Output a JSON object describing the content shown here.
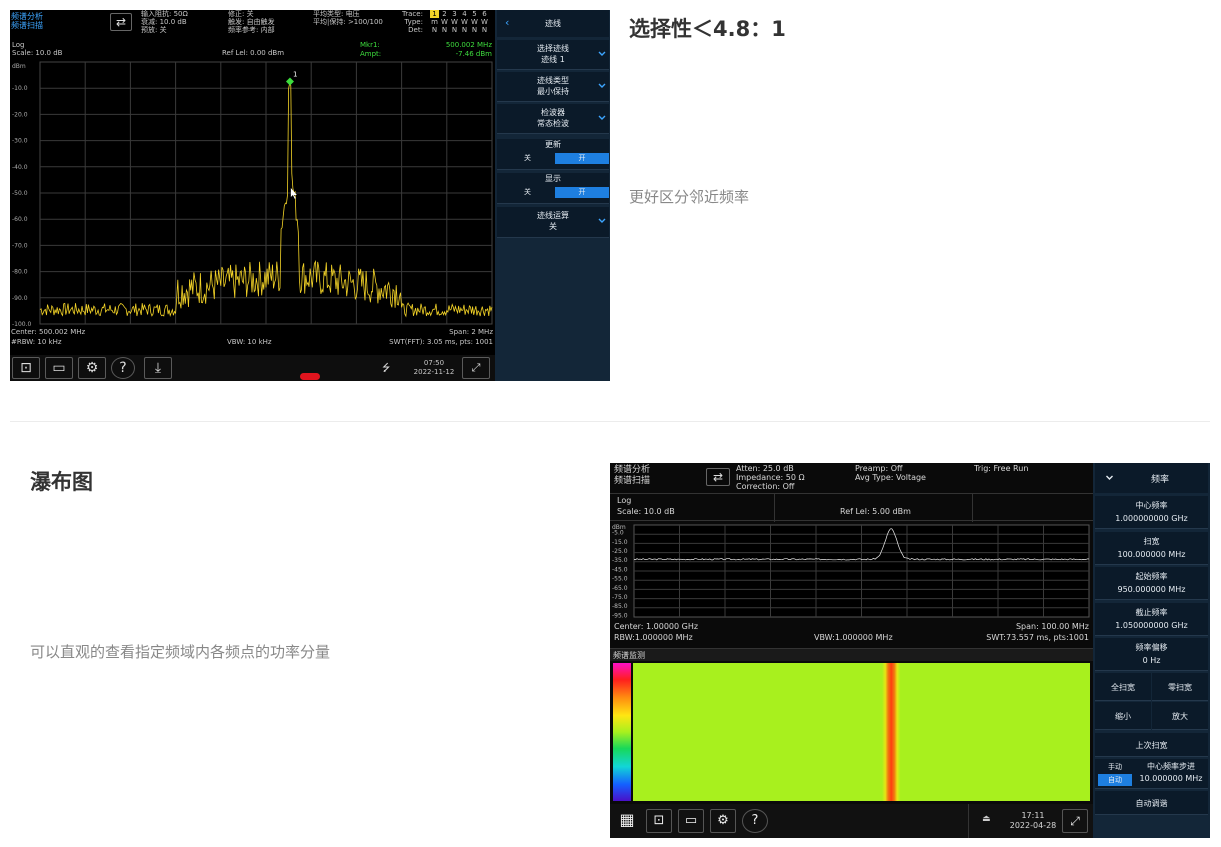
{
  "section1": {
    "title": "选择性＜4.8：1",
    "description": "更好区分邻近频率",
    "instrument": {
      "mode_line1": "频谱分析",
      "mode_line2": "频谱扫描",
      "hdr_col1": "输入阻抗: 50Ω\n衰减: 10.0 dB\n预放: 关",
      "hdr_col2": "修正: 关\n触发: 自由触发\n频率参考: 内部",
      "hdr_col3": "平均类型: 电压\n平均|保持: >100/100",
      "trace_label": "Trace:\nType:\nDet:",
      "trace_nums": [
        "1",
        "2",
        "3",
        "4",
        "5",
        "6"
      ],
      "trace_types": [
        "m",
        "W",
        "W",
        "W",
        "W",
        "W"
      ],
      "trace_dets": [
        "N",
        "N",
        "N",
        "N",
        "N",
        "N"
      ],
      "scale_type": "Log",
      "scale": "Scale: 10.0 dB",
      "ref_level": "Ref Lel: 0.00 dBm",
      "marker_label": "Mkr1:",
      "marker_freq": "500.002 MHz",
      "ampt_label": "Ampt:",
      "marker_ampt": "-7.46 dBm",
      "marker_num": "1",
      "y_unit": "dBm",
      "y_ticks": [
        "-10.0",
        "-20.0",
        "-30.0",
        "-40.0",
        "-50.0",
        "-60.0",
        "-70.0",
        "-80.0",
        "-90.0",
        "-100.0"
      ],
      "center": "Center: 500.002 MHz",
      "span": "Span: 2 MHz",
      "rbw": "#RBW: 10 kHz",
      "vbw": "VBW: 10 kHz",
      "swt": "SWT(FFT): 3.05 ms, pts: 1001",
      "time": "07:50",
      "date": "2022-11-12",
      "usb_icon": "usb-icon",
      "menu_title": "迹线",
      "menu": [
        {
          "l1": "选择迹线",
          "l2": "迹线 1"
        },
        {
          "l1": "迹线类型",
          "l2": "最小保持"
        },
        {
          "l1": "检波器",
          "l2": "常态检波"
        }
      ],
      "update_label": "更新",
      "display_label": "显示",
      "off": "关",
      "on": "开",
      "trace_math_l1": "迹线运算",
      "trace_math_l2": "关",
      "colors": {
        "trace": "#f3d327",
        "marker": "#3ddc3d",
        "accent": "#1e7fe0"
      }
    }
  },
  "section2": {
    "title": "瀑布图",
    "description": "可以直观的查看指定频域内各频点的功率分量",
    "instrument": {
      "mode_line1": "频谱分析",
      "mode_line2": "频谱扫描",
      "hdr_col1": "Atten: 25.0 dB\nImpedance: 50 Ω\nCorrection: Off",
      "hdr_col2": "Preamp: Off\nAvg Type: Voltage",
      "hdr_col3": "Trig: Free Run",
      "scale_type": "Log",
      "scale": "Scale: 10.0 dB",
      "ref_level": "Ref Lel: 5.00 dBm",
      "y_unit": "dBm",
      "y_ticks": [
        "-5.0",
        "-15.0",
        "-25.0",
        "-35.0",
        "-45.0",
        "-55.0",
        "-65.0",
        "-75.0",
        "-85.0",
        "-95.0"
      ],
      "center": "Center: 1.00000 GHz",
      "span": "Span: 100.00 MHz",
      "rbw": "RBW:1.000000 MHz",
      "vbw": "VBW:1.000000 MHz",
      "swt": "SWT:73.557 ms, pts:1001",
      "waterfall_label": "频谱监测",
      "time": "17:11",
      "date": "2022-04-28",
      "menu_title": "频率",
      "menu": [
        {
          "l1": "中心频率",
          "l2": "1.000000000 GHz"
        },
        {
          "l1": "扫宽",
          "l2": "100.000000 MHz"
        },
        {
          "l1": "起始频率",
          "l2": "950.000000 MHz"
        },
        {
          "l1": "截止频率",
          "l2": "1.050000000 GHz"
        },
        {
          "l1": "频率偏移",
          "l2": "0 Hz"
        }
      ],
      "full_span": "全扫宽",
      "zero_span": "零扫宽",
      "zoom_out": "缩小",
      "zoom_in": "放大",
      "last_span": "上次扫宽",
      "manual": "手动",
      "auto": "自动",
      "cf_step_l1": "中心频率步进",
      "cf_step_l2": "10.000000 MHz",
      "auto_tune": "自动调谐",
      "colors": {
        "waterfall_bg": "#a8f01e",
        "peak": "#f07b10",
        "accent": "#1e7fe0"
      }
    }
  }
}
